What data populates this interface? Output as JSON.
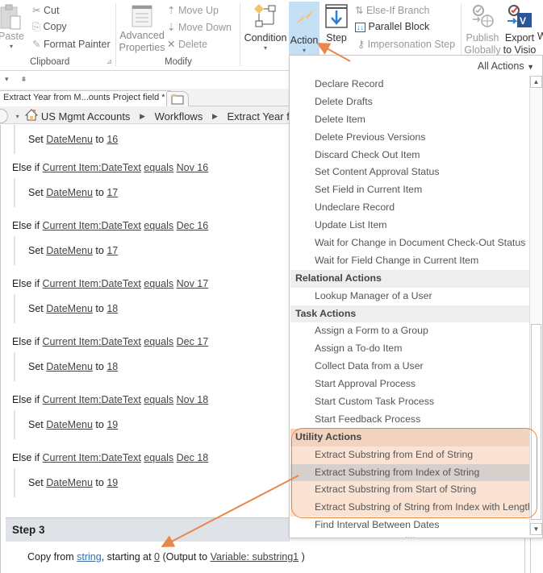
{
  "ribbon": {
    "clipboard": {
      "paste": "Paste",
      "cut": "Cut",
      "copy": "Copy",
      "format_painter": "Format Painter",
      "group_label": "Clipboard"
    },
    "modify": {
      "advanced_properties_1": "Advanced",
      "advanced_properties_2": "Properties",
      "move_up": "Move Up",
      "move_down": "Move Down",
      "delete": "Delete",
      "group_label": "Modify"
    },
    "insert": {
      "condition": "Condition",
      "action": "Action",
      "step": "Step",
      "else_if_branch": "Else-If Branch",
      "parallel_block": "Parallel Block",
      "impersonation_step": "Impersonation Step"
    },
    "manage": {
      "publish_1": "Publish",
      "publish_2": "Globally",
      "export_1": "Export",
      "export_2": "to Visio",
      "partial": "W"
    }
  },
  "tab": {
    "title": "Extract Year from M...ounts Project field *"
  },
  "breadcrumb": {
    "items": [
      "US Mgmt Accounts",
      "Workflows",
      "Extract Year from M"
    ]
  },
  "workflow": {
    "first_set": {
      "prefix": "Set",
      "field": "DateMenu",
      "to": "to",
      "value": "16"
    },
    "branches": [
      {
        "else_if": "Else if",
        "field": "Current Item:DateText",
        "op": "equals",
        "value": "Nov 16",
        "set_prefix": "Set",
        "set_field": "DateMenu",
        "set_to": "to",
        "set_value": "17"
      },
      {
        "else_if": "Else if",
        "field": "Current Item:DateText",
        "op": "equals",
        "value": "Dec 16",
        "set_prefix": "Set",
        "set_field": "DateMenu",
        "set_to": "to",
        "set_value": "17"
      },
      {
        "else_if": "Else if",
        "field": "Current Item:DateText",
        "op": "equals",
        "value": "Nov 17",
        "set_prefix": "Set",
        "set_field": "DateMenu",
        "set_to": "to",
        "set_value": "18"
      },
      {
        "else_if": "Else if",
        "field": "Current Item:DateText",
        "op": "equals",
        "value": "Dec 17",
        "set_prefix": "Set",
        "set_field": "DateMenu",
        "set_to": "to",
        "set_value": "18"
      },
      {
        "else_if": "Else if",
        "field": "Current Item:DateText",
        "op": "equals",
        "value": "Nov 18",
        "set_prefix": "Set",
        "set_field": "DateMenu",
        "set_to": "to",
        "set_value": "19"
      },
      {
        "else_if": "Else if",
        "field": "Current Item:DateText",
        "op": "equals",
        "value": "Dec 18",
        "set_prefix": "Set",
        "set_field": "DateMenu",
        "set_to": "to",
        "set_value": "19"
      }
    ],
    "step3": {
      "title": "Step 3",
      "copy_from": "Copy from",
      "string_link": "string",
      "starting_at": ", starting at",
      "index_link": "0",
      "output_open": "(Output to",
      "variable_link": "Variable: substring1",
      "output_close": ")"
    }
  },
  "dropdown": {
    "header": "All Actions",
    "rows": [
      {
        "type": "item",
        "label": "Declare Record"
      },
      {
        "type": "item",
        "label": "Delete Drafts"
      },
      {
        "type": "item",
        "label": "Delete Item"
      },
      {
        "type": "item",
        "label": "Delete Previous Versions"
      },
      {
        "type": "item",
        "label": "Discard Check Out Item"
      },
      {
        "type": "item",
        "label": "Set Content Approval Status"
      },
      {
        "type": "item",
        "label": "Set Field in Current Item"
      },
      {
        "type": "item",
        "label": "Undeclare Record"
      },
      {
        "type": "item",
        "label": "Update List Item"
      },
      {
        "type": "item",
        "label": "Wait for Change in Document Check-Out Status"
      },
      {
        "type": "item",
        "label": "Wait for Field Change in Current Item"
      },
      {
        "type": "category",
        "label": "Relational Actions"
      },
      {
        "type": "item",
        "label": "Lookup Manager of a User"
      },
      {
        "type": "category",
        "label": "Task Actions"
      },
      {
        "type": "item",
        "label": "Assign a Form to a Group"
      },
      {
        "type": "item",
        "label": "Assign a To-do Item"
      },
      {
        "type": "item",
        "label": "Collect Data from a User"
      },
      {
        "type": "item",
        "label": "Start Approval Process"
      },
      {
        "type": "item",
        "label": "Start Custom Task Process"
      },
      {
        "type": "item",
        "label": "Start Feedback Process"
      },
      {
        "type": "category",
        "label": "Utility Actions",
        "highlight": true
      },
      {
        "type": "item",
        "label": "Extract Substring from End of String",
        "highlight": true
      },
      {
        "type": "item",
        "label": "Extract Substring from Index of String",
        "highlight": true,
        "selected": true
      },
      {
        "type": "item",
        "label": "Extract Substring from Start of String",
        "highlight": true
      },
      {
        "type": "item",
        "label": "Extract Substring of String from Index with Length",
        "highlight": true
      },
      {
        "type": "item",
        "label": "Find Interval Between Dates"
      }
    ],
    "more_indicator": "...."
  },
  "colors": {
    "annotation_orange": "#e8874a",
    "action_button_bg": "#c5dff5",
    "highlight_bg": "#fbe3d3",
    "selected_bg": "#d6cfcb"
  }
}
